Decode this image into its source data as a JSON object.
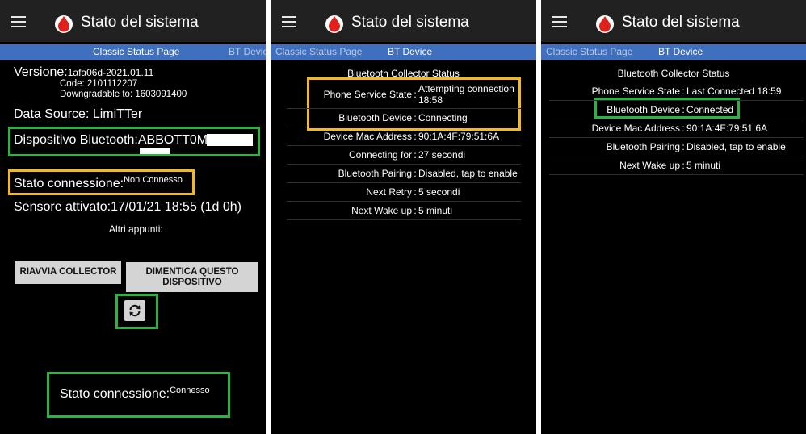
{
  "app": {
    "title": "Stato del sistema"
  },
  "tabs": {
    "classic": "Classic Status Page",
    "bt": "BT Device"
  },
  "classic": {
    "version_label": "Versione:",
    "version_value": "1afa06d-2021.01.11",
    "code": "Code: 2101112207",
    "downgradable": "Downgradable to: 1603091400",
    "data_source": "Data Source: LimiTTer",
    "bt_device_label": "Dispositivo Bluetooth:",
    "bt_device_value": "ABBOTT0M",
    "connection_label": "Stato connessione:",
    "connection_value": "Non Connesso",
    "sensor": "Sensore attivato:17/01/21 18:55 (1d 0h)",
    "other_notes": "Altri appunti:",
    "restart_button": "RIAVVIA COLLECTOR",
    "forget_button": "DIMENTICA QUESTO DISPOSITIVO",
    "connected_label": "Stato connessione:",
    "connected_value": "Connesso"
  },
  "bt_attempt": {
    "header": "Bluetooth Collector Status",
    "rows": [
      {
        "label": "Phone Service State",
        "value": "Attempting connection 18:58"
      },
      {
        "label": "Bluetooth Device",
        "value": "Connecting"
      },
      {
        "label": "Device Mac Address",
        "value": "90:1A:4F:79:51:6A"
      },
      {
        "label": "Connecting for",
        "value": "27 secondi"
      },
      {
        "label": "Bluetooth Pairing",
        "value": "Disabled, tap to enable"
      },
      {
        "label": "Next Retry",
        "value": "5 secondi"
      },
      {
        "label": "Next Wake up",
        "value": "5 minuti"
      }
    ]
  },
  "bt_connected": {
    "header": "Bluetooth Collector Status",
    "rows": [
      {
        "label": "Phone Service State",
        "value": "Last Connected 18:59"
      },
      {
        "label": "Bluetooth Device",
        "value": "Connected"
      },
      {
        "label": "Device Mac Address",
        "value": "90:1A:4F:79:51:6A"
      },
      {
        "label": "Bluetooth Pairing",
        "value": "Disabled, tap to enable"
      },
      {
        "label": "Next Wake up",
        "value": "5 minuti"
      }
    ]
  },
  "colors": {
    "highlight_green": "#2fb144",
    "highlight_yellow": "#f5b820",
    "tab_bar": "#3f6fbf",
    "app_bar": "#212121",
    "logo_red": "#e0201b"
  },
  "icons": {
    "menu": "hamburger-menu-icon",
    "logo": "blood-drop-icon",
    "refresh": "refresh-icon"
  }
}
